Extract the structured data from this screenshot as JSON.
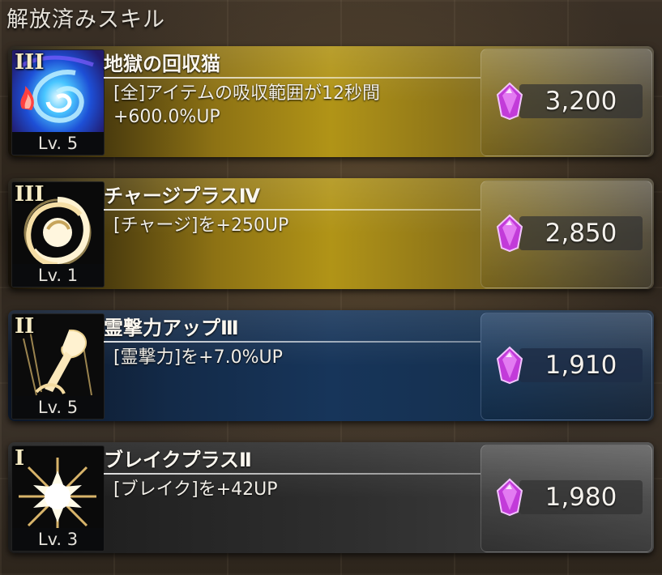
{
  "header": {
    "title": "解放済みスキル"
  },
  "colors": {
    "gold": "#b19417",
    "blue": "#17355a",
    "gray": "#3a3a3a",
    "gem": "#c23bd9"
  },
  "skills": [
    {
      "rank": "III",
      "level": "Lv. 5",
      "name": "地獄の回収猫",
      "desc_line1": "[全]アイテムの吸収範囲が12秒間",
      "desc_line2": "+600.0%UP",
      "cost": "3,200",
      "style": "gold",
      "icon": "vortex-icon"
    },
    {
      "rank": "III",
      "level": "Lv. 1",
      "name": "チャージプラスⅣ",
      "desc_line1": "[チャージ]を+250UP",
      "desc_line2": "",
      "cost": "2,850",
      "style": "gold",
      "icon": "charge-swirl-icon"
    },
    {
      "rank": "II",
      "level": "Lv. 5",
      "name": "霊撃力アップⅢ",
      "desc_line1": "[霊撃力]を+7.0%UP",
      "desc_line2": "",
      "cost": "1,910",
      "style": "blue",
      "icon": "spirit-attack-icon"
    },
    {
      "rank": "I",
      "level": "Lv. 3",
      "name": "ブレイクプラスⅡ",
      "desc_line1": "[ブレイク]を+42UP",
      "desc_line2": "",
      "cost": "1,980",
      "style": "gray",
      "icon": "break-burst-icon"
    }
  ]
}
